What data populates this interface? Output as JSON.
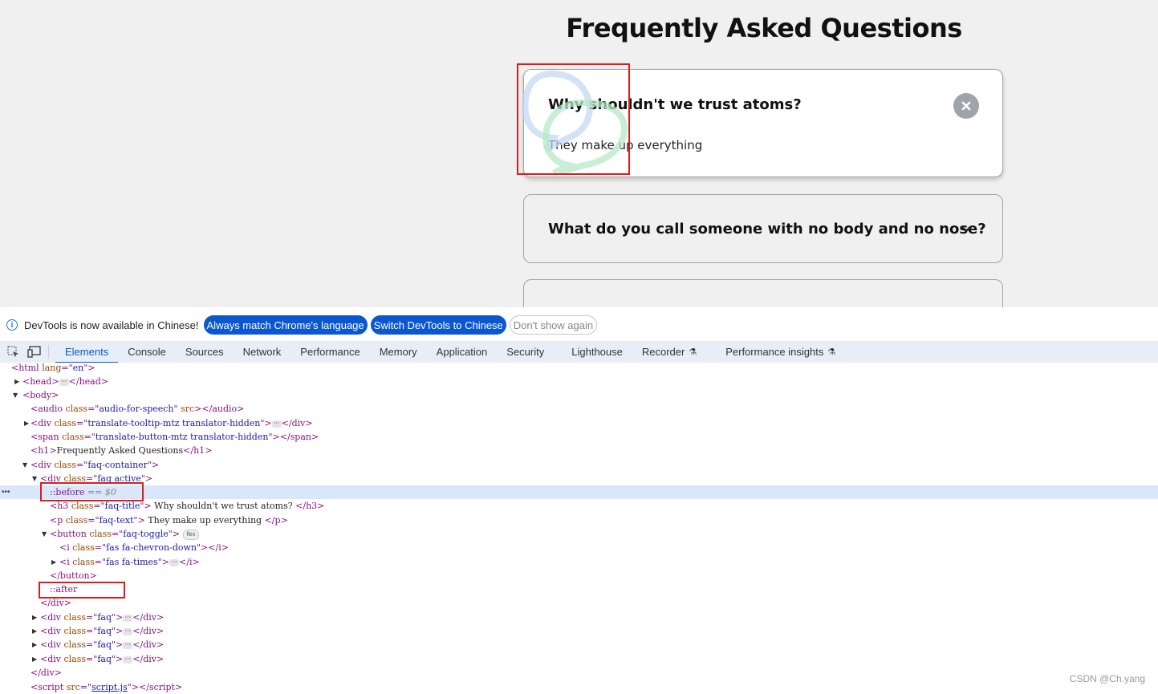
{
  "page": {
    "title": "Frequently Asked Questions",
    "faqs": [
      {
        "question": "Why shouldn't we trust atoms?",
        "answer": "They make up everything",
        "state": "active",
        "toggle_icon": "times-icon"
      },
      {
        "question": "What do you call someone with no body and no nose?",
        "state": "collapsed",
        "toggle_icon": "chevron-down-icon"
      }
    ],
    "colors": {
      "page_bg": "#f0f0f0",
      "toggle_bg": "#9fa4a8",
      "highlight_box": "#e01b1b"
    }
  },
  "infobar": {
    "message": "DevTools is now available in Chinese!",
    "btn_match": "Always match Chrome's language",
    "btn_switch": "Switch DevTools to Chinese",
    "btn_dismiss": "Don't show again"
  },
  "tabs": [
    "Elements",
    "Console",
    "Sources",
    "Network",
    "Performance",
    "Memory",
    "Application",
    "Security",
    "Lighthouse",
    "Recorder",
    "Performance insights"
  ],
  "dom": {
    "html_open": {
      "tag": "html",
      "attr": "lang",
      "value": "en"
    },
    "head": "head",
    "body": "body",
    "audio": {
      "tag": "audio",
      "cls": "audio-for-speech",
      "extra": "src"
    },
    "tooltip_div": {
      "tag": "div",
      "cls": "translate-tooltip-mtz translator-hidden"
    },
    "span": {
      "tag": "span",
      "cls": "translate-button-mtz translator-hidden"
    },
    "h1": {
      "tag": "h1",
      "text": "Frequently Asked Questions"
    },
    "container": {
      "tag": "div",
      "cls": "faq-container"
    },
    "active": {
      "tag": "div",
      "cls": "faq active"
    },
    "before": "::before",
    "before_ref": "== $0",
    "h3": {
      "tag": "h3",
      "cls": "faq-title",
      "text": " Why shouldn't we trust atoms? "
    },
    "p": {
      "tag": "p",
      "cls": "faq-text",
      "text": " They make up everything "
    },
    "button": {
      "tag": "button",
      "cls": "faq-toggle",
      "badge": "flex"
    },
    "i_chevron": {
      "tag": "i",
      "cls": "fas fa-chevron-down"
    },
    "i_times": {
      "tag": "i",
      "cls": "fas fa-times"
    },
    "button_close": "/button",
    "after": "::after",
    "div_close": "/div",
    "faq_cls": "faq",
    "container_close": "/div",
    "script": {
      "tag": "script",
      "attr": "src",
      "value": "script.js"
    }
  },
  "watermark": "CSDN @Ch.yang"
}
